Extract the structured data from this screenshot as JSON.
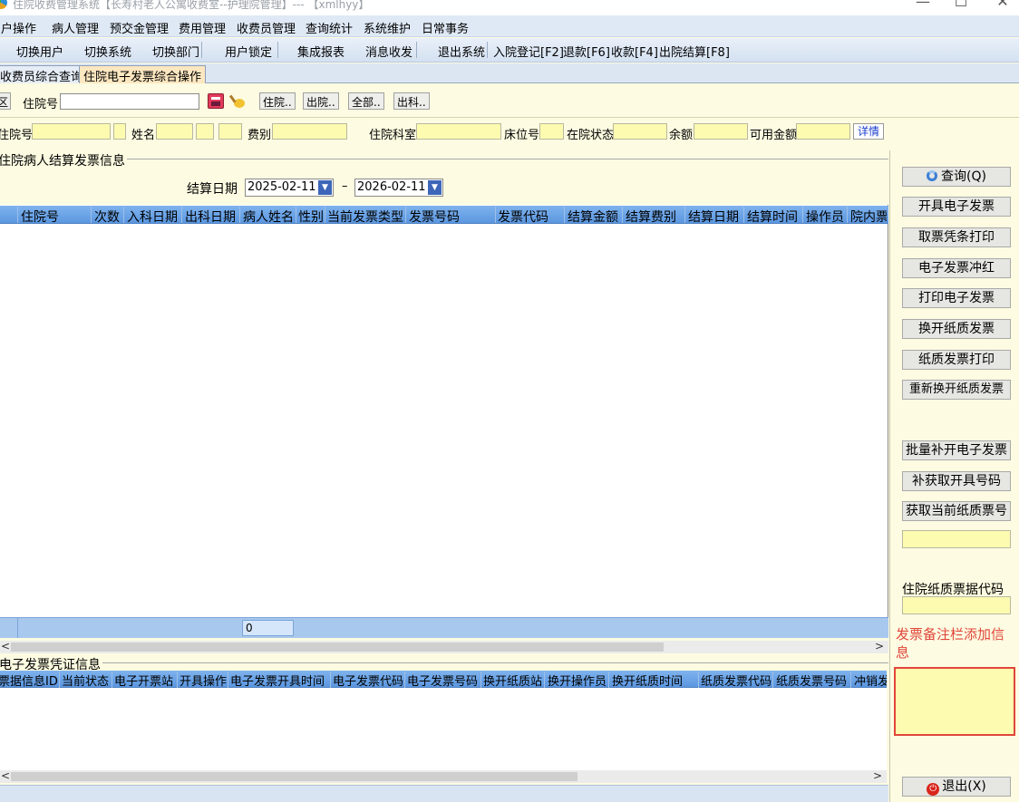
{
  "window": {
    "title": "住院收费管理系统【长寿村老人公寓收费室--护理院管理】--- 【xmlhyy】",
    "minimize": "—",
    "maximize": "☐",
    "close": "✕"
  },
  "menu": [
    "用户操作",
    "病人管理",
    "预交金管理",
    "费用管理",
    "收费员管理",
    "查询统计",
    "系统维护",
    "日常事务"
  ],
  "toolbar": [
    "切换用户",
    "切换系统",
    "切换部门",
    "用户锁定",
    "集成报表",
    "消息收发",
    "退出系统",
    "入院登记[F2]",
    "退款[F6]",
    "收款[F4]",
    "出院结算[F8]"
  ],
  "tabs": [
    "收费员综合查询",
    "住院电子发票综合操作"
  ],
  "search": {
    "truncated_label": "区",
    "zyh_label": "住院号",
    "zyh_value": "",
    "btn_zhuyuan": "住院..",
    "btn_chuyuan": "出院..",
    "btn_quanbu": "全部..",
    "btn_chuke": "出科.."
  },
  "info": {
    "zyh_label": "住院号",
    "name_label": "姓名",
    "feibie_label": "费别",
    "keshi_label": "住院科室",
    "bed_label": "床位号",
    "status_label": "在院状态",
    "balance_label": "余额",
    "avail_label": "可用金额",
    "detail_link": "详情"
  },
  "settle": {
    "group_title": "住院病人结算发票信息",
    "date_label": "结算日期",
    "date_from": "2025-02-11",
    "date_sep": "–",
    "date_to": "2026-02-11"
  },
  "grid1": {
    "columns": [
      "住院号",
      "次数",
      "入科日期",
      "出科日期",
      "病人姓名",
      "性别",
      "当前发票类型",
      "发票号码",
      "发票代码",
      "结算金额",
      "结算费别",
      "结算日期",
      "结算时间",
      "操作员",
      "院内票"
    ],
    "rows": [],
    "footer_total": "0"
  },
  "grid2": {
    "group_title": "电子发票凭证信息",
    "columns": [
      "票据信息ID",
      "当前状态",
      "电子开票站",
      "开具操作",
      "电子发票开具时间",
      "电子发票代码",
      "电子发票号码",
      "换开纸质站",
      "换开操作员",
      "换开纸质时间",
      "纸质发票代码",
      "纸质发票号码",
      "冲销发"
    ],
    "rows": []
  },
  "right_panel": {
    "buttons": [
      "查询(Q)",
      "开具电子发票",
      "取票凭条打印",
      "电子发票冲红",
      "打印电子发票",
      "换开纸质发票",
      "纸质发票打印",
      "重新换开纸质发票",
      "批量补开电子发票",
      "补获取开具号码",
      "获取当前纸质票号"
    ],
    "paper_code_label": "住院纸质票据代码",
    "remark_label": "发票备注栏添加信息",
    "remark_value": "",
    "exit_button": "退出(X)"
  },
  "colors": {
    "accent_red": "#e0463a",
    "grid_header": "#6aa3e8",
    "field_yellow": "#fdfbb0"
  }
}
